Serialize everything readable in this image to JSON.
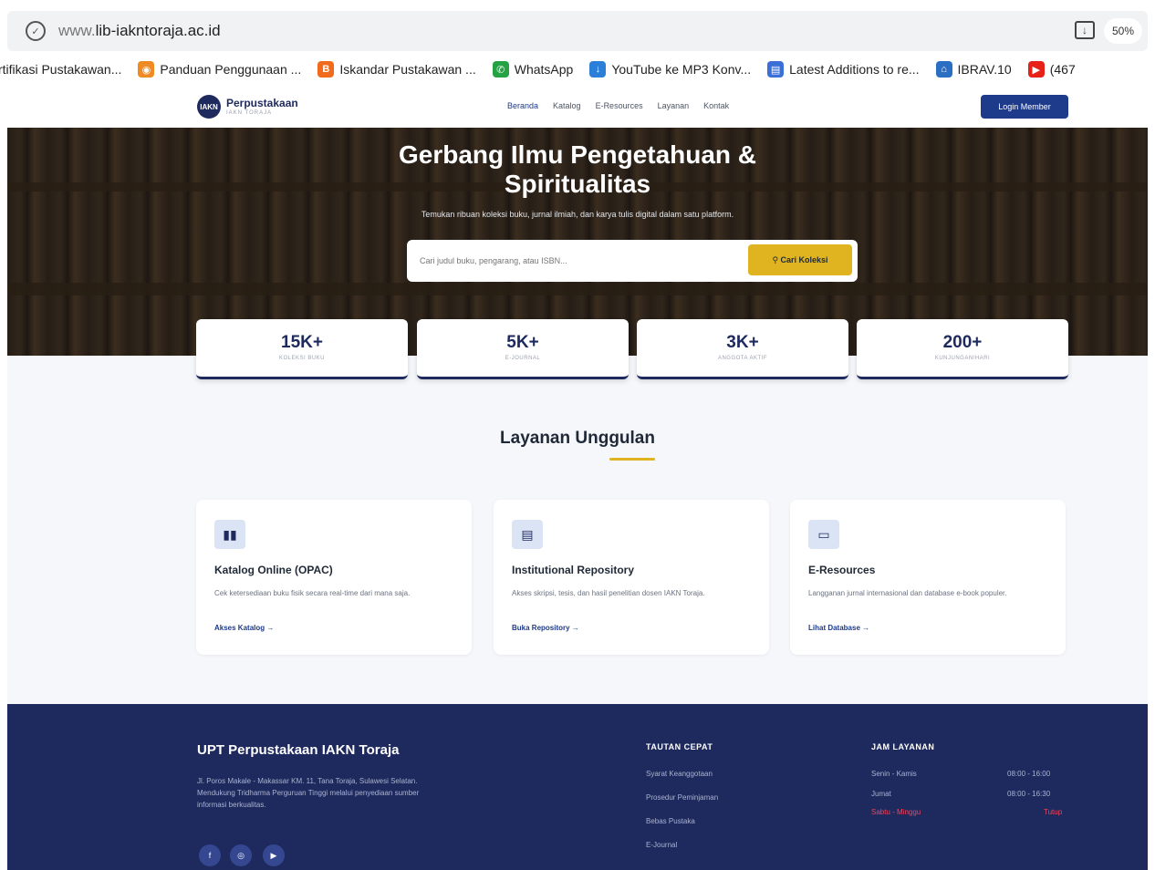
{
  "browser": {
    "url_prefix": "www.",
    "url_host": "lib-iakntoraja.ac.id",
    "zoom": "50%",
    "bookmarks": [
      {
        "label": "rtifikasi Pustakawan...",
        "color": "#ffffff",
        "icon": ""
      },
      {
        "label": "Panduan Penggunaan ...",
        "color": "#f08a24",
        "icon": "panduan-icon"
      },
      {
        "label": "Iskandar Pustakawan ...",
        "color": "#f26b1d",
        "icon": "blogger-icon"
      },
      {
        "label": "WhatsApp",
        "color": "#25a244",
        "icon": "whatsapp-icon"
      },
      {
        "label": "YouTube ke MP3 Konv...",
        "color": "#2b7fd8",
        "icon": "download-cloud-icon"
      },
      {
        "label": "Latest Additions to re...",
        "color": "#3a6fd8",
        "icon": "document-icon"
      },
      {
        "label": "IBRAV.10",
        "color": "#2b6fc4",
        "icon": "ibrav-icon"
      },
      {
        "label": "(467",
        "color": "#e62117",
        "icon": "youtube-icon"
      }
    ]
  },
  "nav": {
    "logo_title": "Perpustakaan",
    "logo_sub": "IAKN TORAJA",
    "logo_mark": "IAKN",
    "links": [
      "Beranda",
      "Katalog",
      "E-Resources",
      "Layanan",
      "Kontak"
    ],
    "login": "Login Member"
  },
  "hero": {
    "title_line1": "Gerbang Ilmu Pengetahuan &",
    "title_line2": "Spiritualitas",
    "subtitle": "Temukan ribuan koleksi buku, jurnal ilmiah, dan karya tulis digital dalam satu platform.",
    "search_placeholder": "Cari judul buku, pengarang, atau ISBN...",
    "search_button": "Cari Koleksi"
  },
  "stats": [
    {
      "value": "15K+",
      "label": "KOLEKSI BUKU"
    },
    {
      "value": "5K+",
      "label": "E-JOURNAL"
    },
    {
      "value": "3K+",
      "label": "ANGGOTA AKTIF"
    },
    {
      "value": "200+",
      "label": "KUNJUNGAN/HARI"
    }
  ],
  "services": {
    "title": "Layanan Unggulan",
    "cards": [
      {
        "icon": "book-open-icon",
        "title": "Katalog Online (OPAC)",
        "desc": "Cek ketersediaan buku fisik secara real-time dari mana saja.",
        "link": "Akses Katalog →"
      },
      {
        "icon": "archive-icon",
        "title": "Institutional Repository",
        "desc": "Akses skripsi, tesis, dan hasil penelitian dosen IAKN Toraja.",
        "link": "Buka Repository →"
      },
      {
        "icon": "laptop-icon",
        "title": "E-Resources",
        "desc": "Langganan jurnal internasional dan database e-book populer.",
        "link": "Lihat Database →"
      }
    ]
  },
  "footer": {
    "title": "UPT Perpustakaan IAKN Toraja",
    "desc": "Jl. Poros Makale - Makassar KM. 11, Tana Toraja, Sulawesi Selatan. Mendukung Tridharma Perguruan Tinggi melalui penyediaan sumber informasi berkualitas.",
    "quick_links_title": "TAUTAN CEPAT",
    "quick_links": [
      "Syarat Keanggotaan",
      "Prosedur Peminjaman",
      "Bebas Pustaka",
      "E-Journal"
    ],
    "hours_title": "JAM LAYANAN",
    "hours": [
      {
        "day": "Senin - Kamis",
        "time": "08:00 - 16:00",
        "closed": false
      },
      {
        "day": "Jumat",
        "time": "08:00 - 16:30",
        "closed": false
      },
      {
        "day": "Sabtu - Minggu",
        "time": "Tutup",
        "closed": true
      }
    ],
    "social": [
      "facebook-icon",
      "instagram-icon",
      "youtube-icon"
    ]
  }
}
